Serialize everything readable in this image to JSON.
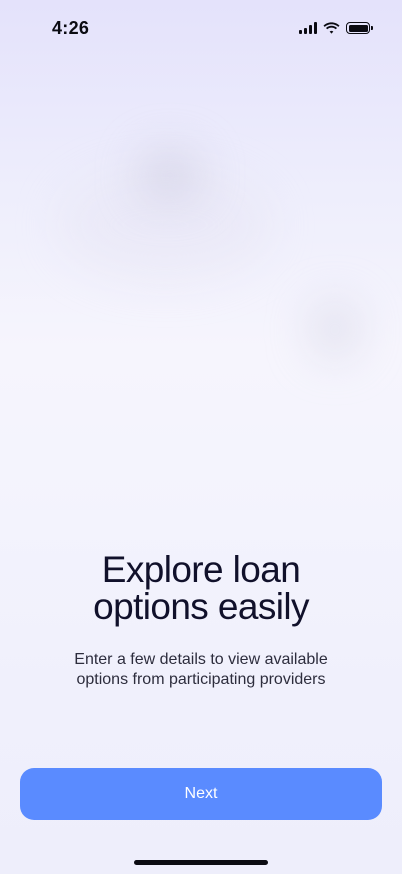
{
  "status_bar": {
    "time": "4:26",
    "icons": [
      "cellular-signal-icon",
      "wifi-icon",
      "battery-icon"
    ]
  },
  "onboarding": {
    "headline_line1": "Explore loan",
    "headline_line2": "options easily",
    "subtext_line1": "Enter a few details to view available",
    "subtext_line2": "options from participating providers"
  },
  "actions": {
    "next_label": "Next"
  },
  "colors": {
    "accent": "#5a8bff",
    "text_primary": "#11112b",
    "text_secondary": "#2d2d3d",
    "background_top": "#e4e2fb"
  }
}
